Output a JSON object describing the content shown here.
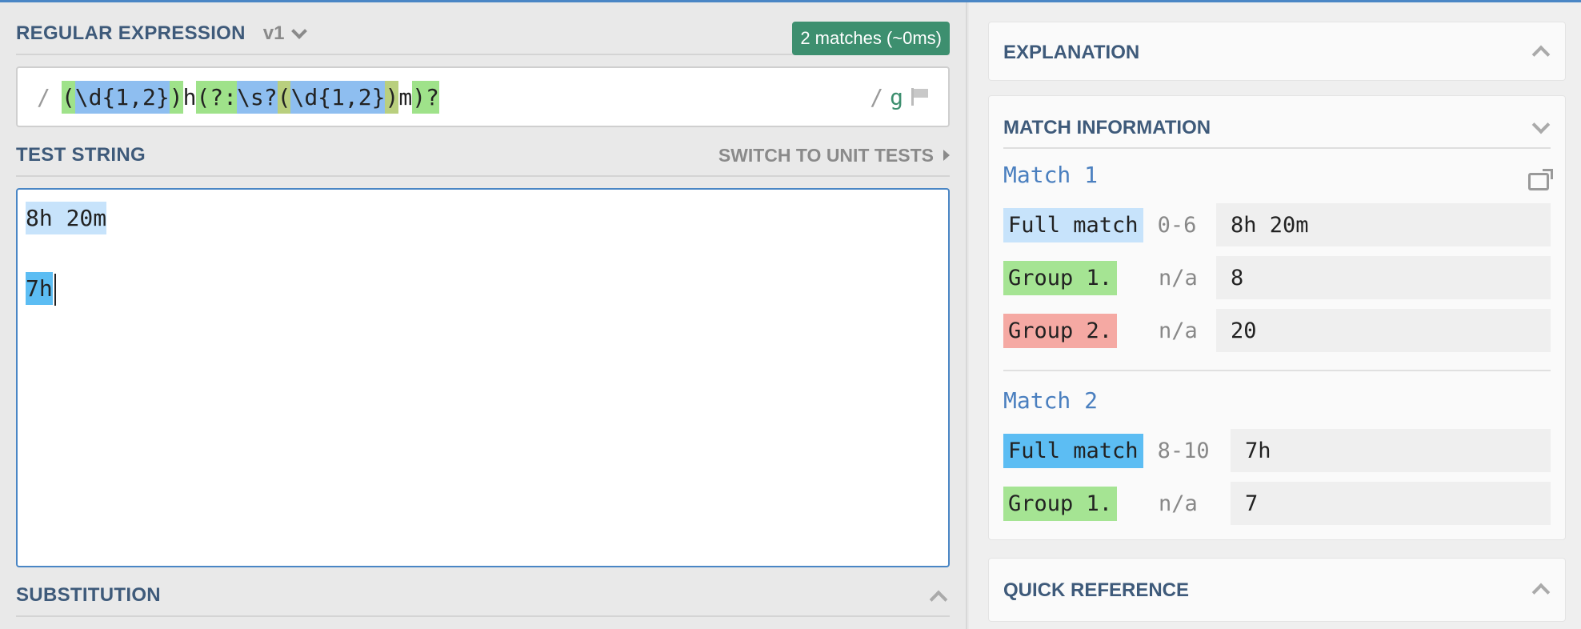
{
  "regex_section": {
    "title": "REGULAR EXPRESSION",
    "version": "v1",
    "match_badge": "2 matches (~0ms)",
    "delimiter_open": "/",
    "tokens": [
      {
        "text": "(",
        "hl": "tg"
      },
      {
        "text": "\\d{1,2}",
        "hl": "tb"
      },
      {
        "text": ")",
        "hl": "tg"
      },
      {
        "text": "h",
        "hl": ""
      },
      {
        "text": "(?:",
        "hl": "tg"
      },
      {
        "text": "\\s?",
        "hl": "tb"
      },
      {
        "text": "(",
        "hl": "to"
      },
      {
        "text": "\\d{1,2}",
        "hl": "tb"
      },
      {
        "text": ")",
        "hl": "to"
      },
      {
        "text": "m",
        "hl": ""
      },
      {
        "text": ")?",
        "hl": "tg"
      }
    ],
    "delimiter_close": "/",
    "flags": "g"
  },
  "test_section": {
    "title": "TEST STRING",
    "switch_label": "SWITCH TO UNIT TESTS",
    "lines": [
      "8h 20m",
      "",
      "7h"
    ]
  },
  "substitution_section": {
    "title": "SUBSTITUTION"
  },
  "explanation": {
    "title": "EXPLANATION"
  },
  "match_information": {
    "title": "MATCH INFORMATION",
    "matches": [
      {
        "title": "Match 1",
        "rows": [
          {
            "label": "Full match",
            "range": "0-6",
            "value": "8h 20m"
          },
          {
            "label": "Group 1.",
            "range": "n/a",
            "value": "8"
          },
          {
            "label": "Group 2.",
            "range": "n/a",
            "value": "20"
          }
        ]
      },
      {
        "title": "Match 2",
        "rows": [
          {
            "label": "Full match",
            "range": "8-10",
            "value": "7h"
          },
          {
            "label": "Group 1.",
            "range": "n/a",
            "value": "7"
          }
        ]
      }
    ]
  },
  "quick_reference": {
    "title": "QUICK REFERENCE"
  },
  "colors": {
    "accent": "#4a86c5",
    "badge": "#3d8f6f",
    "heading": "#3e5a7a",
    "full_match_1": "#c7e3fb",
    "full_match_2": "#5cbdf3",
    "group_1": "#a5e493",
    "group_2": "#f5a9a3"
  }
}
